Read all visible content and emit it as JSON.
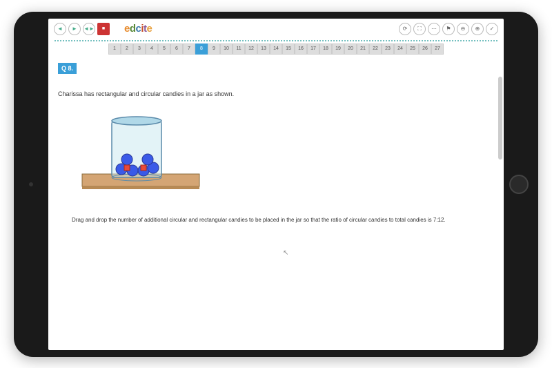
{
  "logo": {
    "e1": "e",
    "d": "d",
    "c": "c",
    "i": "i",
    "t": "t",
    "e2": "e"
  },
  "toolbar": {
    "back": "◄",
    "fwd": "►",
    "bookmark": "◄►",
    "stop": "■",
    "refresh": "⟳",
    "fullscreen": "⛶",
    "flag": "⚑",
    "zoomout": "⊖",
    "zoomin": "⊕",
    "check": "✓"
  },
  "qnums": {
    "list": [
      "1",
      "2",
      "3",
      "4",
      "5",
      "6",
      "7",
      "8",
      "9",
      "10",
      "11",
      "12",
      "13",
      "14",
      "15",
      "16",
      "17",
      "18",
      "19",
      "20",
      "21",
      "22",
      "23",
      "24",
      "25",
      "26",
      "27"
    ],
    "active": 8
  },
  "question": {
    "badge": "Q 8.",
    "text": "Charissa has rectangular and circular candies in a jar as shown.",
    "instruction": "Drag and drop the number of additional circular and rectangular candies to be placed in the jar so that the ratio of circular candies to total candies is 7:12."
  }
}
